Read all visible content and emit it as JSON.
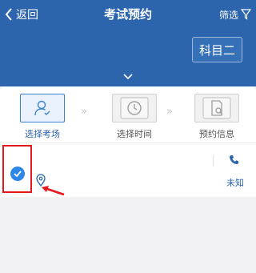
{
  "header": {
    "back_label": "返回",
    "title": "考试预约",
    "filter_label": "筛选",
    "subject_label": "科目二"
  },
  "steps": [
    {
      "label": "选择考场",
      "state": "active",
      "icon": "user-check-icon"
    },
    {
      "label": "选择时间",
      "state": "inactive",
      "icon": "clock-icon"
    },
    {
      "label": "预约信息",
      "state": "inactive",
      "icon": "document-search-icon"
    }
  ],
  "step_separator": "»",
  "site": {
    "status_text": "未知",
    "selected": true
  },
  "colors": {
    "brand": "#2c64ad",
    "accent": "#2e86e6",
    "highlight": "#e5161c"
  }
}
